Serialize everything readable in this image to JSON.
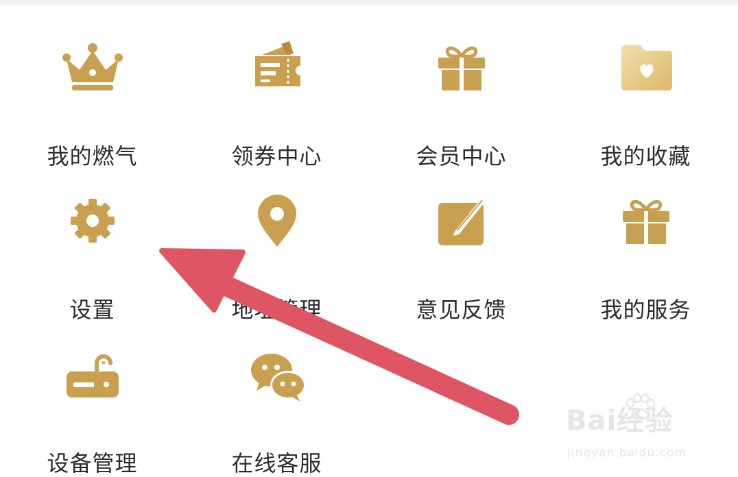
{
  "colors": {
    "gold": "#c9a050",
    "gold_dark": "#b8893e",
    "gold_light": "#e8cf8f",
    "arrow_red": "#de5563",
    "label": "#2b2b2b"
  },
  "menu": {
    "items": [
      {
        "label": "我的燃气",
        "icon": "crown-icon"
      },
      {
        "label": "领券中心",
        "icon": "coupon-icon"
      },
      {
        "label": "会员中心",
        "icon": "gift-icon"
      },
      {
        "label": "我的收藏",
        "icon": "heart-folder-icon"
      },
      {
        "label": "设置",
        "icon": "gear-icon"
      },
      {
        "label": "地址管理",
        "icon": "location-pin-icon"
      },
      {
        "label": "意见反馈",
        "icon": "edit-note-icon"
      },
      {
        "label": "我的服务",
        "icon": "gift-icon"
      },
      {
        "label": "设备管理",
        "icon": "router-icon"
      },
      {
        "label": "在线客服",
        "icon": "chat-bubbles-icon"
      }
    ]
  },
  "watermark": {
    "brand": "Bai经验",
    "url": "jingyan.baidu.com"
  }
}
